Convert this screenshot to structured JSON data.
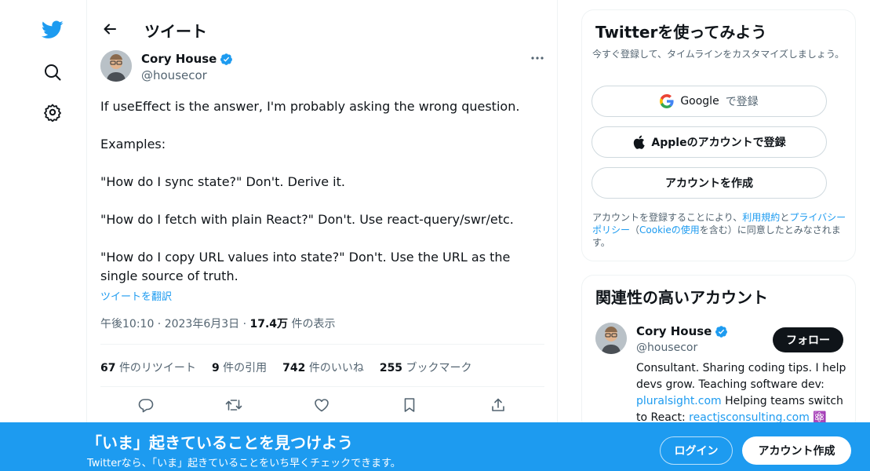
{
  "theme": {
    "accent": "#1d9bf0",
    "text": "#0f1419",
    "muted": "#536471",
    "border": "#eff3f4"
  },
  "rail": {
    "icons": [
      "twitter-logo-icon",
      "search-icon",
      "settings-gear-icon"
    ]
  },
  "header": {
    "title": "ツイート"
  },
  "tweet": {
    "author_name": "Cory House",
    "author_handle": "@housecor",
    "paragraphs": [
      "If useEffect is the answer, I'm probably asking the wrong question.",
      "Examples:",
      "\"How do I sync state?\" Don't. Derive it.",
      "\"How do I fetch with plain React?\" Don't. Use react-query/swr/etc.",
      "\"How do I copy URL values into state?\" Don't. Use the URL as the single source of truth."
    ],
    "translate_label": "ツイートを翻訳",
    "timestamp": "午後10:10 · 2023年6月3日",
    "views_count": "17.4万",
    "views_label": "件の表示",
    "stats": [
      {
        "count": "67",
        "label": "件のリツイート"
      },
      {
        "count": "9",
        "label": "件の引用"
      },
      {
        "count": "742",
        "label": "件のいいね"
      },
      {
        "count": "255",
        "label": "ブックマーク"
      }
    ]
  },
  "signup_card": {
    "title": "Twitterを使ってみよう",
    "subtitle": "今すぐ登録して、タイムラインをカスタマイズしましょう。",
    "google_label": "Google",
    "google_suffix": "で登録",
    "apple_label": "Appleのアカウントで登録",
    "create_label": "アカウントを作成",
    "legal_prefix": "アカウントを登録することにより、",
    "legal_terms": "利用規約",
    "legal_and": "と",
    "legal_privacy": "プライバシーポリシー",
    "legal_paren_open": "（",
    "legal_cookie": "Cookieの使用",
    "legal_suffix": "を含む）に同意したとみなされます。"
  },
  "related": {
    "title": "関連性の高いアカウント",
    "name": "Cory House",
    "handle": "@housecor",
    "follow_label": "フォロー",
    "bio_text": "Consultant. Sharing coding tips. I help devs grow. Teaching software dev:",
    "bio_link1": "pluralsight.com",
    "bio_mid": "Helping teams switch to React:",
    "bio_link2": "reactjsconsulting.com",
    "bio_emoji": "⚛️"
  },
  "banner": {
    "title": "「いま」起きていることを見つけよう",
    "subtitle": "Twitterなら、「いま」起きていることをいち早くチェックできます。",
    "login_label": "ログイン",
    "signup_label": "アカウント作成"
  }
}
